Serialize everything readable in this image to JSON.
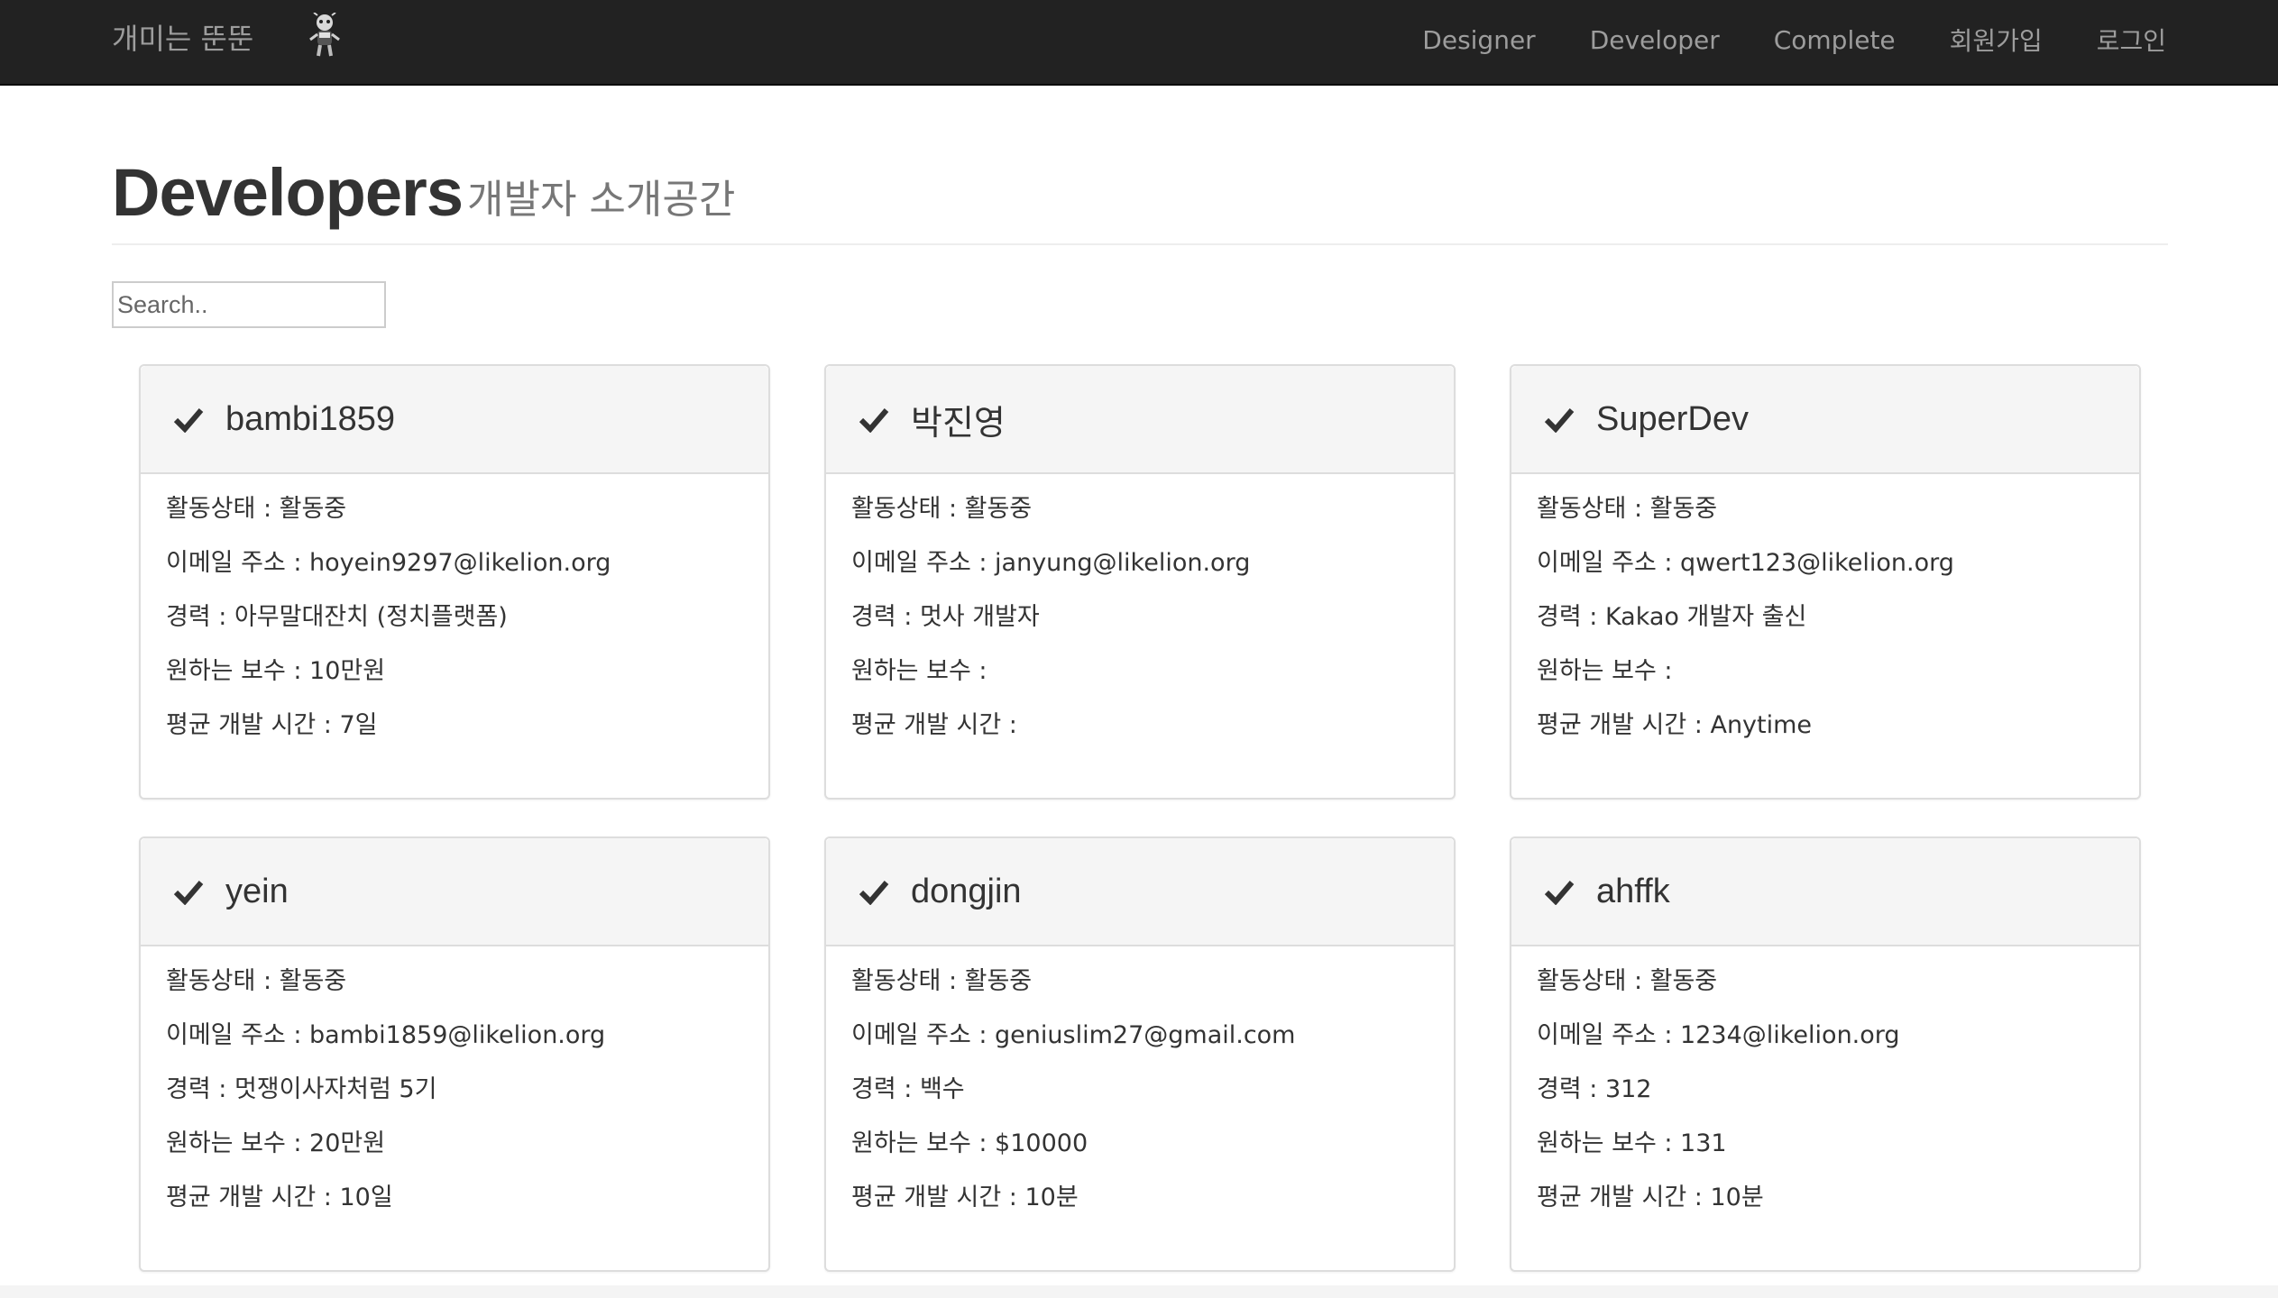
{
  "navbar": {
    "brand": "개미는 뚠뚠",
    "links": [
      "Designer",
      "Developer",
      "Complete",
      "회원가입",
      "로그인"
    ]
  },
  "header": {
    "title": "Developers",
    "subtitle": "개발자 소개공간"
  },
  "search": {
    "placeholder": "Search.."
  },
  "labels": {
    "status": "활동상태 : ",
    "email": "이메일 주소 : ",
    "career": "경력 : ",
    "salary": "원하는 보수 : ",
    "time": "평균 개발 시간 : "
  },
  "cards": [
    {
      "name": "bambi1859",
      "status": "활동중",
      "email": "hoyein9297@likelion.org",
      "career": "아무말대잔치 (정치플랫폼)",
      "salary": "10만원",
      "time": "7일"
    },
    {
      "name": "박진영",
      "status": "활동중",
      "email": "janyung@likelion.org",
      "career": "멋사 개발자",
      "salary": "",
      "time": ""
    },
    {
      "name": "SuperDev",
      "status": "활동중",
      "email": "qwert123@likelion.org",
      "career": "Kakao 개발자 출신",
      "salary": "",
      "time": "Anytime"
    },
    {
      "name": "yein",
      "status": "활동중",
      "email": "bambi1859@likelion.org",
      "career": "멋쟁이사자처럼 5기",
      "salary": "20만원",
      "time": "10일"
    },
    {
      "name": "dongjin",
      "status": "활동중",
      "email": "geniuslim27@gmail.com",
      "career": "백수",
      "salary": "$10000",
      "time": "10분"
    },
    {
      "name": "ahffk",
      "status": "활동중",
      "email": "1234@likelion.org",
      "career": "312",
      "salary": "131",
      "time": "10분"
    }
  ]
}
